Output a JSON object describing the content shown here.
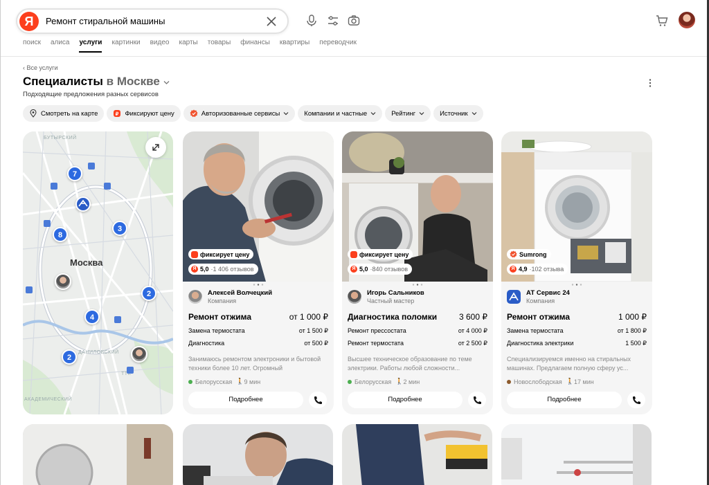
{
  "header": {
    "logo": "Я",
    "search_query": "Ремонт стиральной машины",
    "nav_tabs": [
      {
        "label": "поиск",
        "active": false
      },
      {
        "label": "алиса",
        "active": false
      },
      {
        "label": "услуги",
        "active": true
      },
      {
        "label": "картинки",
        "active": false
      },
      {
        "label": "видео",
        "active": false
      },
      {
        "label": "карты",
        "active": false
      },
      {
        "label": "товары",
        "active": false
      },
      {
        "label": "финансы",
        "active": false
      },
      {
        "label": "квартиры",
        "active": false
      },
      {
        "label": "переводчик",
        "active": false
      }
    ]
  },
  "page": {
    "breadcrumb": "‹ Все услуги",
    "title_main": "Специалисты",
    "title_city": "в Москве",
    "subtitle": "Подходящие предложения разных сервисов"
  },
  "filters": [
    {
      "label": "Смотреть на карте",
      "icon": "map-pin-icon",
      "dropdown": false
    },
    {
      "label": "Фиксируют цену",
      "icon": "fixed-price-icon",
      "dropdown": false
    },
    {
      "label": "Авторизованные сервисы",
      "icon": "verified-badge-icon",
      "dropdown": true
    },
    {
      "label": "Компании и частные",
      "dropdown": true
    },
    {
      "label": "Рейтинг",
      "dropdown": true
    },
    {
      "label": "Источник",
      "dropdown": true
    }
  ],
  "map": {
    "city_label": "Москва",
    "district_labels": [
      "БУТЫРСКИЙ",
      "ДАНИЛОВСКИЙ",
      "АКАДЕМИЧЕСКИЙ",
      "ТТК"
    ],
    "clusters": [
      "7",
      "3",
      "8",
      "2",
      "4",
      "2"
    ]
  },
  "cards": [
    {
      "badge": "фиксирует цену",
      "rating": "5,0",
      "reviews": "1 406 отзывов",
      "name": "Алексей Волчецкий",
      "role": "Компания",
      "service": "Ремонт отжима",
      "price": "от 1 000 ₽",
      "sub": [
        {
          "name": "Замена термостата",
          "price": "от 1 500 ₽"
        },
        {
          "name": "Диагностика",
          "price": "от 500 ₽"
        }
      ],
      "description": "Занимаюсь ремонтом электроники и бытовой техники более 10 лет. Огромный",
      "metro": "Белорусская",
      "metro_color": "#4caf50",
      "walk": "9 мин",
      "button": "Подробнее"
    },
    {
      "badge": "фиксирует цену",
      "rating": "5,0",
      "reviews": "840 отзывов",
      "name": "Игорь Сальников",
      "role": "Частный мастер",
      "service": "Диагностика поломки",
      "price": "3 600 ₽",
      "sub": [
        {
          "name": "Ремонт прессостата",
          "price": "от 4 000 ₽"
        },
        {
          "name": "Ремонт термостата",
          "price": "от 2 500 ₽"
        }
      ],
      "description": "Высшее техническое образование по теме электрики. Работы любой сложности...",
      "metro": "Белорусская",
      "metro_color": "#4caf50",
      "walk": "2 мин",
      "button": "Подробнее"
    },
    {
      "badge": "Sumrong",
      "rating": "4,9",
      "reviews": "102 отзыва",
      "name": "АТ Сервис 24",
      "role": "Компания",
      "service": "Ремонт отжима",
      "price": "1 000 ₽",
      "sub": [
        {
          "name": "Замена термостата",
          "price": "от 1 800 ₽"
        },
        {
          "name": "Диагностика электрики",
          "price": "1 500 ₽"
        }
      ],
      "description": "Специализируемся именно на стиральных машинах. Предлагаем полную сферу ус...",
      "metro": "Новослободская",
      "metro_color": "#8d5b2d",
      "walk": "17 мин",
      "button": "Подробнее"
    }
  ]
}
